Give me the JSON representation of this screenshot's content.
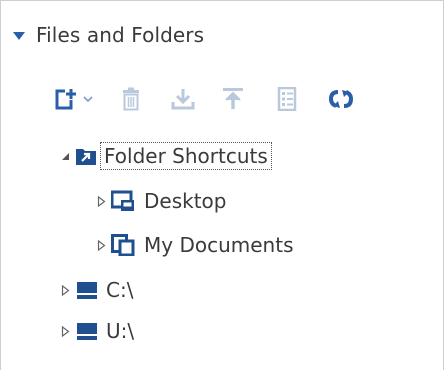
{
  "section": {
    "title": "Files and Folders",
    "expanded": true
  },
  "toolbar": {
    "new_label": "New",
    "delete_label": "Delete",
    "download_label": "Download",
    "upload_label": "Upload",
    "properties_label": "Properties",
    "refresh_label": "Refresh",
    "icon_color": "#2a5fa8",
    "disabled_color": "#b9c8da"
  },
  "tree": {
    "items": [
      {
        "label": "Folder Shortcuts",
        "icon": "folder-shortcut-icon",
        "expanded": true,
        "focused": true
      },
      {
        "label": "Desktop",
        "icon": "desktop-icon",
        "expanded": false
      },
      {
        "label": "My Documents",
        "icon": "documents-icon",
        "expanded": false
      },
      {
        "label": "C:\\",
        "icon": "drive-icon",
        "expanded": false
      },
      {
        "label": "U:\\",
        "icon": "drive-icon",
        "expanded": false
      }
    ]
  },
  "colors": {
    "accent": "#2a5fa8",
    "text": "#3a3a3a",
    "border": "#cfcfcf"
  }
}
